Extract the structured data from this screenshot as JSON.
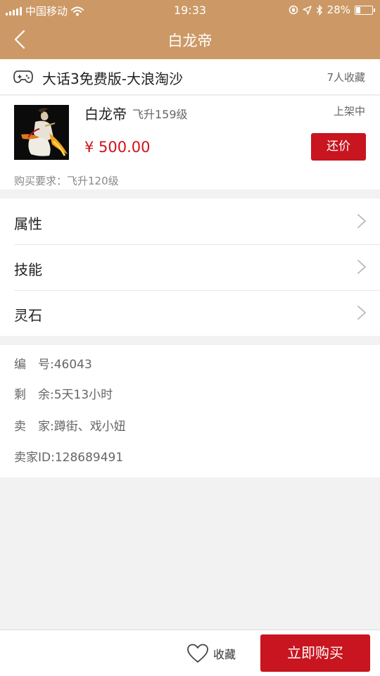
{
  "status_bar": {
    "carrier": "中国移动",
    "time": "19:33",
    "battery_percent": "28%",
    "battery_level": 0.28,
    "icons": [
      "signal-icon",
      "wifi-icon",
      "orientation-lock-icon",
      "location-icon",
      "bluetooth-icon",
      "battery-icon"
    ]
  },
  "nav": {
    "title": "白龙帝",
    "back_icon": "chevron-left-icon"
  },
  "game": {
    "icon": "gamepad-icon",
    "name": "大话3免费版-大浪淘沙",
    "collect_count": "7人收藏"
  },
  "item": {
    "name": "白龙帝",
    "level": "飞升159级",
    "status": "上架中",
    "price": "¥ 500.00",
    "counter_offer_label": "还价",
    "buy_requirement": "购买要求：飞升120级"
  },
  "menu": {
    "items": [
      {
        "label": "属性"
      },
      {
        "label": "技能"
      },
      {
        "label": "灵石"
      }
    ]
  },
  "info": {
    "serial": "编　号:46043",
    "remaining": "剩　余:5天13小时",
    "seller": "卖　家:蹲街、戏小妞",
    "seller_id": "卖家ID:128689491"
  },
  "bottom": {
    "favorite_label": "收藏",
    "buy_now_label": "立即购买"
  },
  "colors": {
    "header_bg": "#cc9966",
    "accent_red": "#c8151f",
    "price_red": "#d0121b",
    "page_bg": "#f2f2f2"
  }
}
